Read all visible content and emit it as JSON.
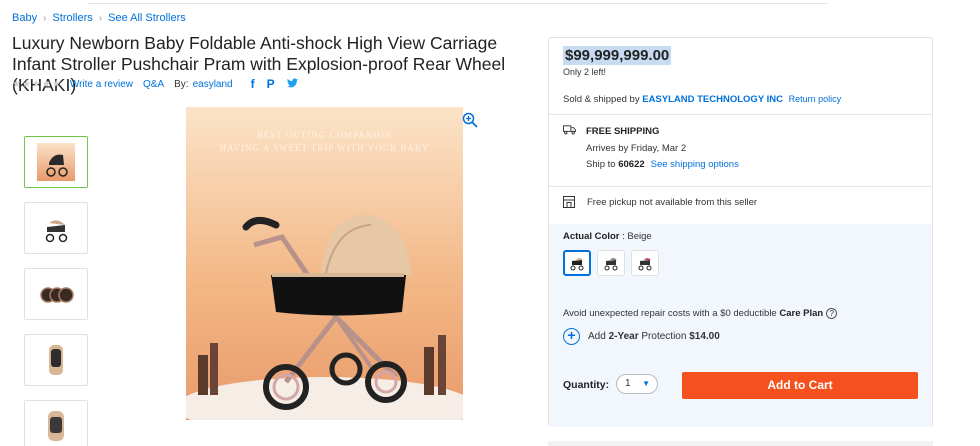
{
  "breadcrumb": {
    "items": [
      "Baby",
      "Strollers",
      "See All Strollers"
    ]
  },
  "product": {
    "title": "Luxury Newborn Baby Foldable Anti-shock High View Carriage Infant Stroller Pushchair Pram with Explosion-proof Rear Wheel (KHAKI)",
    "stars": "★★★★★",
    "write_review": "Write a review",
    "qa": "Q&A",
    "by_label": "By:",
    "brand": "easyland",
    "image_caption_line1": "BEST OUTING COMPANION",
    "image_caption_line2": "HAVING A SWEET TRIP WITH YOUR BABY"
  },
  "social": {
    "facebook": "f",
    "pinterest": "P",
    "twitter": "t"
  },
  "thumbnails": [
    "stroller-front",
    "stroller-side",
    "wheels",
    "seat-top",
    "seat-back"
  ],
  "offer": {
    "price": "$99,999,999.00",
    "stock": "Only 2 left!",
    "sold_prefix": "Sold & shipped by",
    "seller": "EASYLAND TECHNOLOGY INC",
    "return_policy": "Return policy",
    "shipping_title": "FREE SHIPPING",
    "arrives": "Arrives by Friday, Mar 2",
    "ship_to_label": "Ship to",
    "zip": "60622",
    "ship_options": "See shipping options",
    "pickup": "Free pickup not available from this seller",
    "color_label": "Actual Color",
    "color_value": "Beige",
    "care_prefix": "Avoid unexpected repair costs with a $0 deductible",
    "care_plan": "Care Plan",
    "protection_add": "Add",
    "protection_years": "2-Year",
    "protection_label": "Protection",
    "protection_price": "$14.00",
    "quantity_label": "Quantity:",
    "quantity_value": "1",
    "add_to_cart": "Add to Cart"
  },
  "colors": {
    "accent": "#0071dc",
    "cart_button": "#f4511e",
    "price_highlight": "#c7dcf3"
  }
}
